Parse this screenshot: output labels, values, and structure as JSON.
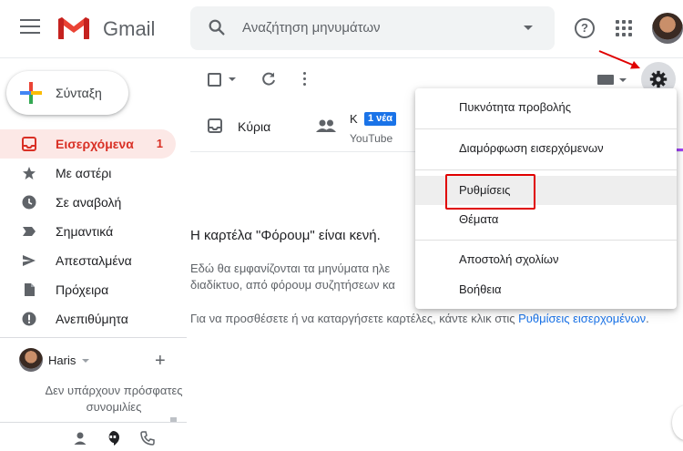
{
  "header": {
    "app_name": "Gmail",
    "search_placeholder": "Αναζήτηση μηνυμάτων"
  },
  "compose": {
    "label": "Σύνταξη"
  },
  "sidebar": {
    "items": [
      {
        "label": "Εισερχόμενα",
        "count": "1",
        "icon": "inbox-icon",
        "active": true
      },
      {
        "label": "Με αστέρι",
        "icon": "star-icon"
      },
      {
        "label": "Σε αναβολή",
        "icon": "clock-icon"
      },
      {
        "label": "Σημαντικά",
        "icon": "important-icon"
      },
      {
        "label": "Απεσταλμένα",
        "icon": "send-icon"
      },
      {
        "label": "Πρόχειρα",
        "icon": "draft-icon"
      },
      {
        "label": "Ανεπιθύμητα",
        "icon": "spam-icon"
      }
    ]
  },
  "hangouts": {
    "user": "Haris",
    "empty_message": "Δεν υπάρχουν πρόσφατες συνομιλίες"
  },
  "tabs": {
    "primary": {
      "label": "Κύρια"
    },
    "social": {
      "label": "Κ",
      "badge": "1 νέα",
      "sub": "YouTube"
    }
  },
  "main": {
    "empty_title": "Η καρτέλα \"Φόρουμ\" είναι κενή.",
    "empty_line1": "Εδώ θα εμφανίζονται τα μηνύματα ηλε",
    "empty_line2": "διαδίκτυο, από φόρουμ συζητήσεων κα",
    "hint_prefix": "Για να προσθέσετε ή να καταργήσετε καρτέλες, κάντε κλικ στις ",
    "hint_link": "Ρυθμίσεις εισερχομένων",
    "hint_suffix": "."
  },
  "settings_menu": {
    "items": [
      {
        "label": "Πυκνότητα προβολής"
      },
      {
        "label": "Διαμόρφωση εισερχόμενων"
      },
      {
        "label": "Ρυθμίσεις",
        "highlighted": true
      },
      {
        "label": "Θέματα"
      },
      {
        "label": "Αποστολή σχολίων"
      },
      {
        "label": "Βοήθεια"
      }
    ]
  },
  "colors": {
    "accent_red": "#d93025",
    "accent_blue": "#1a73e8",
    "annotation_red": "#e00000"
  }
}
